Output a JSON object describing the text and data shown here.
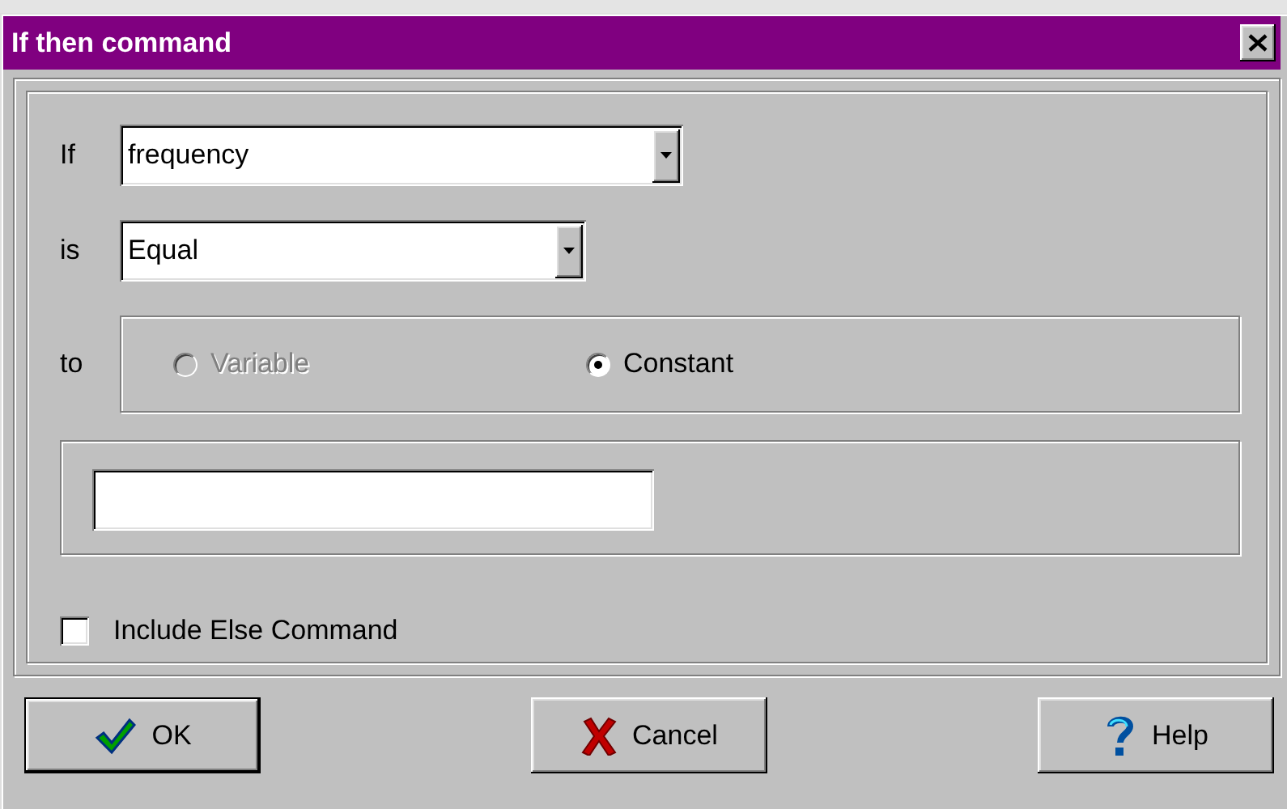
{
  "window": {
    "title": "If then command"
  },
  "condition": {
    "label": "If",
    "value": "frequency"
  },
  "operator": {
    "label": "is",
    "value": "Equal"
  },
  "target": {
    "label": "to",
    "options": [
      {
        "label": "Variable",
        "selected": false,
        "disabled": true
      },
      {
        "label": "Constant",
        "selected": true,
        "disabled": false
      }
    ]
  },
  "include_else": {
    "label": "Include Else Command",
    "checked": false
  },
  "buttons": [
    {
      "label": "OK",
      "kind": "ok",
      "default": true
    },
    {
      "label": "Cancel",
      "kind": "cancel",
      "default": false
    },
    {
      "label": "Help",
      "kind": "help",
      "default": false
    }
  ]
}
